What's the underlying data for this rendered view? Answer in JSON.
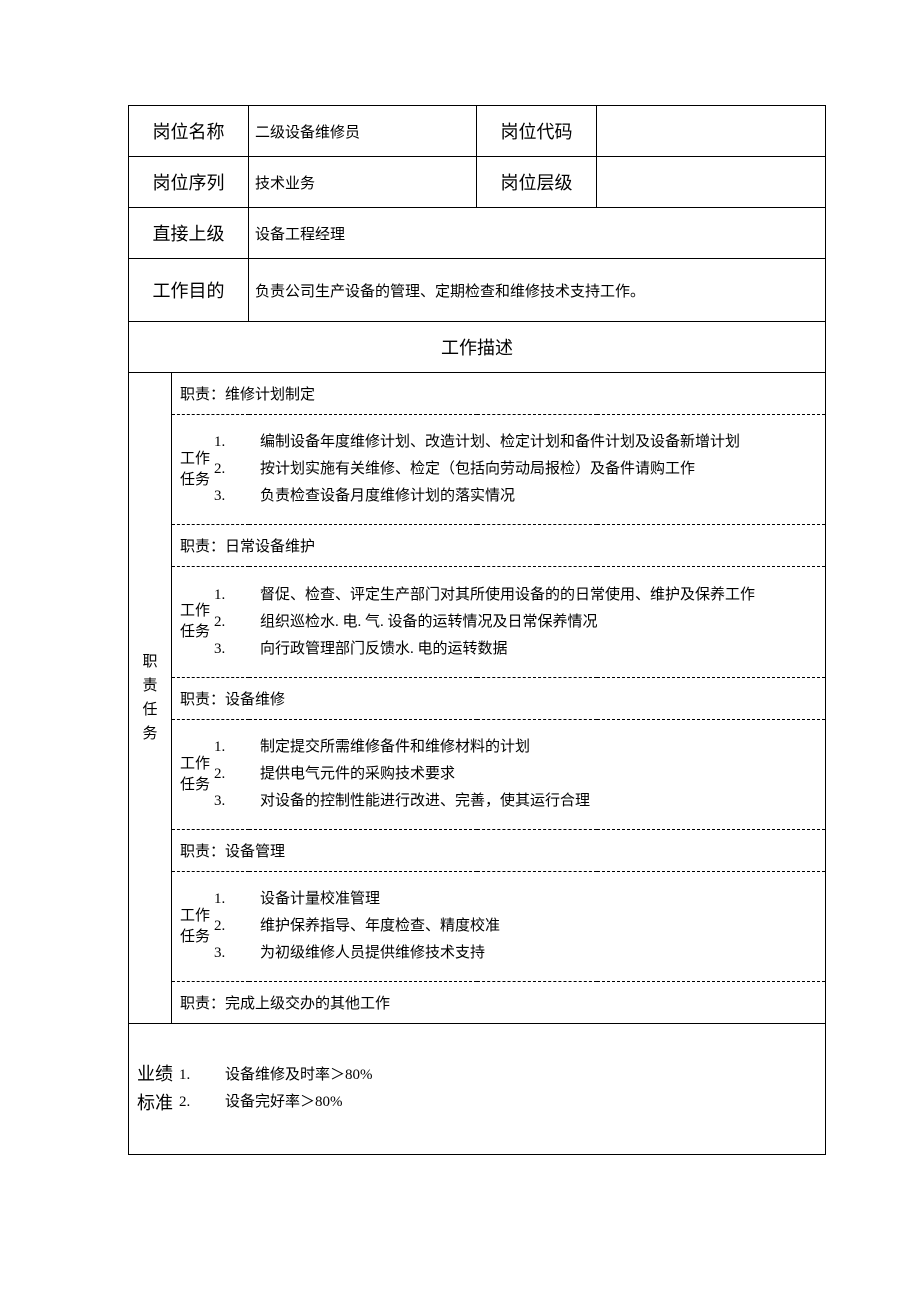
{
  "header": {
    "name_label": "岗位名称",
    "name_value": "二级设备维修员",
    "code_label": "岗位代码",
    "code_value": "",
    "series_label": "岗位序列",
    "series_value": "技术业务",
    "level_label": "岗位层级",
    "level_value": "",
    "superior_label": "直接上级",
    "superior_value": "设备工程经理",
    "purpose_label": "工作目的",
    "purpose_value": "负责公司生产设备的管理、定期检查和维修技术支持工作。"
  },
  "desc_title": "工作描述",
  "side_label_duties": "职责任务",
  "task_label": "工作任务",
  "duties": [
    {
      "title": "职责：维修计划制定",
      "tasks": [
        {
          "n": "1.",
          "t": "编制设备年度维修计划、改造计划、检定计划和备件计划及设备新增计划"
        },
        {
          "n": "2.",
          "t": "按计划实施有关维修、检定（包括向劳动局报检）及备件请购工作"
        },
        {
          "n": "3.",
          "t": "负责检查设备月度维修计划的落实情况"
        }
      ]
    },
    {
      "title": "职责：日常设备维护",
      "tasks": [
        {
          "n": "1.",
          "t": "督促、检查、评定生产部门对其所使用设备的的日常使用、维护及保养工作"
        },
        {
          "n": "2.",
          "t": "组织巡检水. 电. 气. 设备的运转情况及日常保养情况"
        },
        {
          "n": "3.",
          "t": "向行政管理部门反馈水. 电的运转数据"
        }
      ]
    },
    {
      "title": "职责：设备维修",
      "tasks": [
        {
          "n": "1.",
          "t": "制定提交所需维修备件和维修材料的计划"
        },
        {
          "n": "2.",
          "t": "提供电气元件的采购技术要求"
        },
        {
          "n": "3.",
          "t": "对设备的控制性能进行改进、完善，使其运行合理"
        }
      ]
    },
    {
      "title": "职责：设备管理",
      "tasks": [
        {
          "n": "1.",
          "t": "设备计量校准管理"
        },
        {
          "n": "2.",
          "t": "维护保养指导、年度检查、精度校准"
        },
        {
          "n": "3.",
          "t": "为初级维修人员提供维修技术支持"
        }
      ]
    },
    {
      "title": "职责：完成上级交办的其他工作",
      "tasks": []
    }
  ],
  "perf_label": "业绩标准",
  "perf": [
    {
      "n": "1.",
      "t": "设备维修及时率＞80%"
    },
    {
      "n": "2.",
      "t": "设备完好率＞80%"
    }
  ]
}
